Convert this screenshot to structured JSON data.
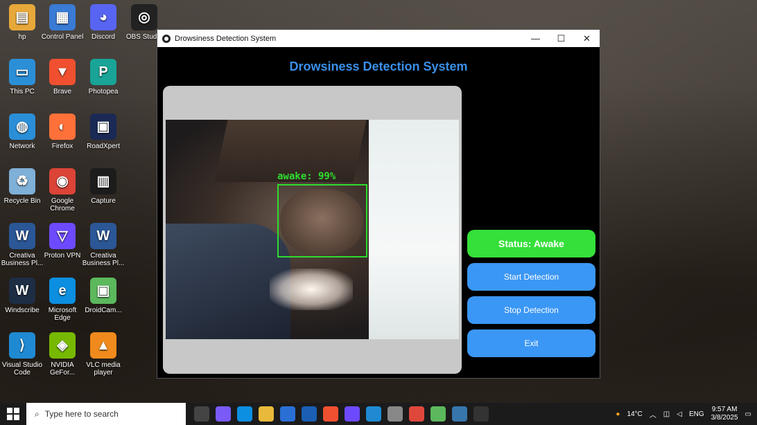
{
  "desktop": {
    "icons": [
      {
        "label": "hp",
        "color": "#e6a83a",
        "glyph": "▤"
      },
      {
        "label": "Control Panel",
        "color": "#3a7bd5",
        "glyph": "▦"
      },
      {
        "label": "Discord",
        "color": "#5865f2",
        "glyph": "◕"
      },
      {
        "label": "OBS Studio",
        "color": "#222222",
        "glyph": "◎"
      },
      {
        "label": "This PC",
        "color": "#2b8fd8",
        "glyph": "▭"
      },
      {
        "label": "Brave",
        "color": "#f0502f",
        "glyph": "▼"
      },
      {
        "label": "Photopea",
        "color": "#18a497",
        "glyph": "P"
      },
      {
        "label": "Network",
        "color": "#2b8fd8",
        "glyph": "◍"
      },
      {
        "label": "Firefox",
        "color": "#ff7139",
        "glyph": "◐"
      },
      {
        "label": "RoadXpert",
        "color": "#1a2a55",
        "glyph": "▣"
      },
      {
        "label": "Recycle Bin",
        "color": "#7fb0d8",
        "glyph": "♻"
      },
      {
        "label": "Google Chrome",
        "color": "#db4437",
        "glyph": "◉"
      },
      {
        "label": "Capture",
        "color": "#1c1c1c",
        "glyph": "▥"
      },
      {
        "label": "Creativa Business Pl...",
        "color": "#2b5797",
        "glyph": "W"
      },
      {
        "label": "Proton VPN",
        "color": "#6d4aff",
        "glyph": "▽"
      },
      {
        "label": "Creativa Business Pl...",
        "color": "#2b5797",
        "glyph": "W"
      },
      {
        "label": "Windscribe",
        "color": "#1d2d44",
        "glyph": "W"
      },
      {
        "label": "Microsoft Edge",
        "color": "#0c8fe0",
        "glyph": "e"
      },
      {
        "label": "DroidCam...",
        "color": "#5cb85c",
        "glyph": "▣"
      },
      {
        "label": "Visual Studio Code",
        "color": "#1f8ad2",
        "glyph": "⟩"
      },
      {
        "label": "NVIDIA GeFor...",
        "color": "#76b900",
        "glyph": "◈"
      },
      {
        "label": "VLC media player",
        "color": "#f08a1c",
        "glyph": "▲"
      }
    ]
  },
  "window": {
    "title": "Drowsiness Detection System",
    "minimize": "—",
    "maximize": "☐",
    "close": "✕"
  },
  "app": {
    "heading": "Drowsiness Detection System",
    "detection_label": "awake: 99%",
    "status": "Status: Awake",
    "start": "Start Detection",
    "stop": "Stop Detection",
    "exit": "Exit"
  },
  "taskbar": {
    "search_placeholder": "Type here to search",
    "weather": "14°C",
    "language": "ENG",
    "time": "9:57 AM",
    "date": "3/8/2025"
  },
  "colors": {
    "accent": "#3b97f5",
    "status_ok": "#35e03a",
    "heading": "#3a8fe8",
    "detect": "#2fdc2f"
  }
}
